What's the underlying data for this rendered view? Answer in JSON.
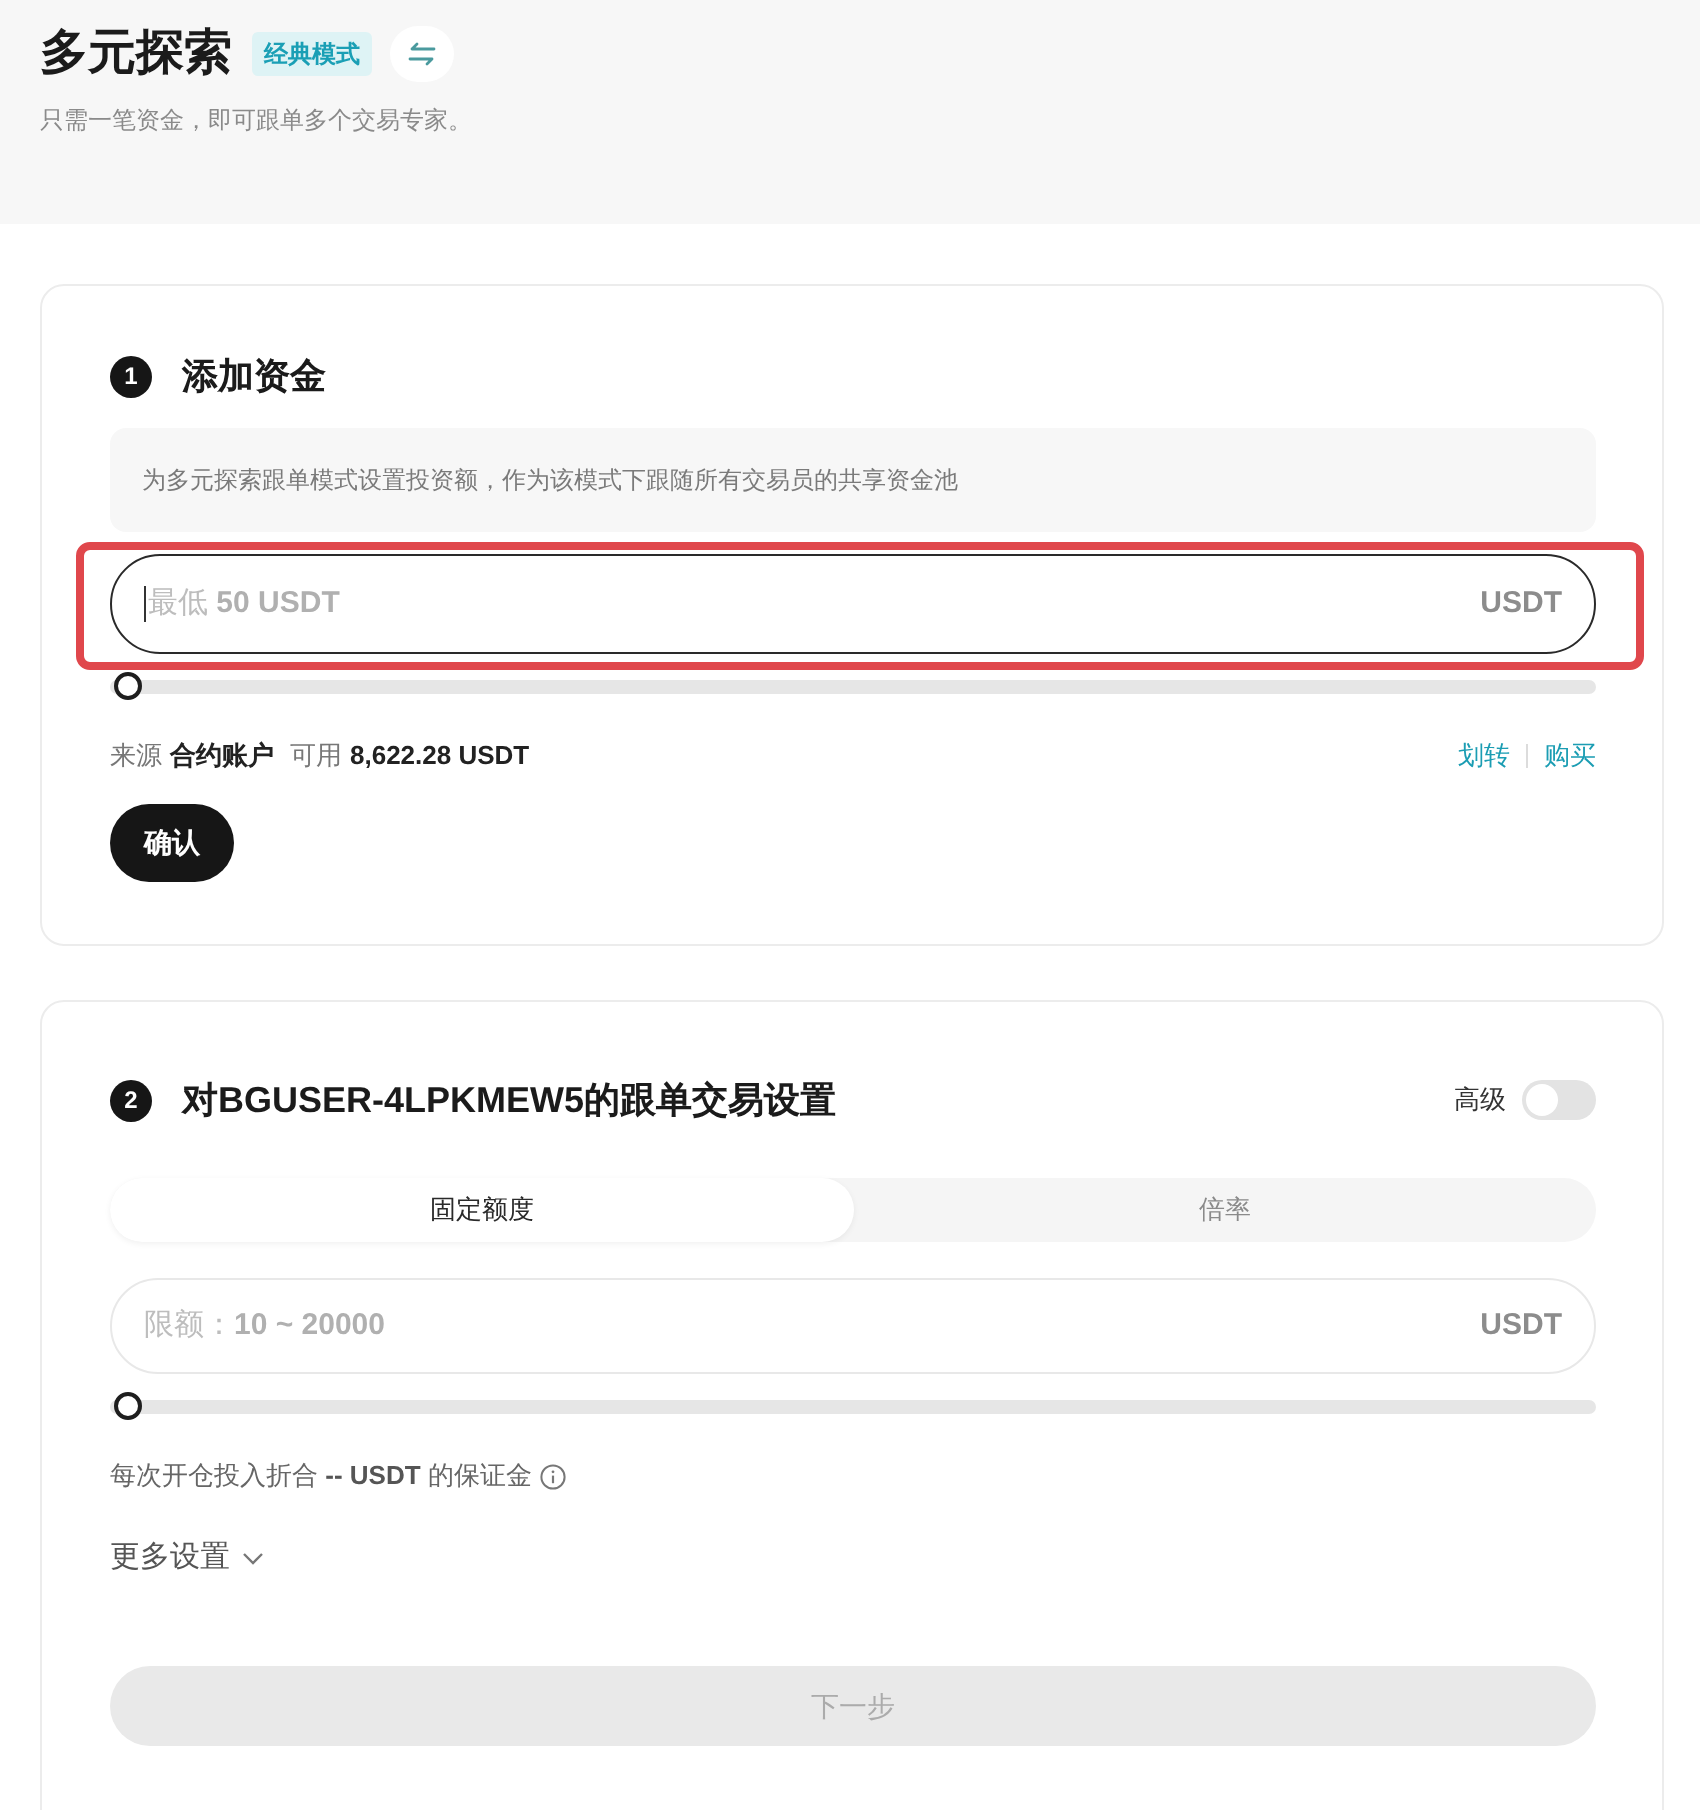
{
  "header": {
    "title": "多元探索",
    "badge": "经典模式",
    "subtitle": "只需一笔资金，即可跟单多个交易专家。"
  },
  "funds_section": {
    "step": "1",
    "title": "添加资金",
    "note": "为多元探索跟单模式设置投资额，作为该模式下跟随所有交易员的共享资金池",
    "amount_field": {
      "placeholder": "最低 **50 USDT**",
      "unit": "USDT",
      "focused": true,
      "highlighted": true
    },
    "slider": {
      "level": 0
    },
    "source_label": "来源",
    "source_account": "合约账户",
    "available_label": "可用",
    "available_amount": "8,622.28 USDT",
    "links": [
      "划转",
      "购买"
    ],
    "confirm_button": "确认"
  },
  "settings_section": {
    "step": "2",
    "title": "对BGUSER-4LPKMEW5的跟单交易设置",
    "advanced_toggle": {
      "label": "高级",
      "on": false
    },
    "tabs": [
      {
        "label": "固定额度",
        "selected": true
      },
      {
        "label": "倍率",
        "selected": false
      }
    ],
    "amount_field": {
      "placeholder": "限额：**10 ~ 20000**",
      "unit": "USDT",
      "focused": false,
      "highlighted": false
    },
    "slider": {
      "level": 0
    },
    "margin_note": "每次开仓投入折合 **-- USDT** 的保证金",
    "more_settings": {
      "label": "更多设置",
      "expanded": false
    },
    "next_button": {
      "label": "下一步",
      "disabled": true
    }
  }
}
